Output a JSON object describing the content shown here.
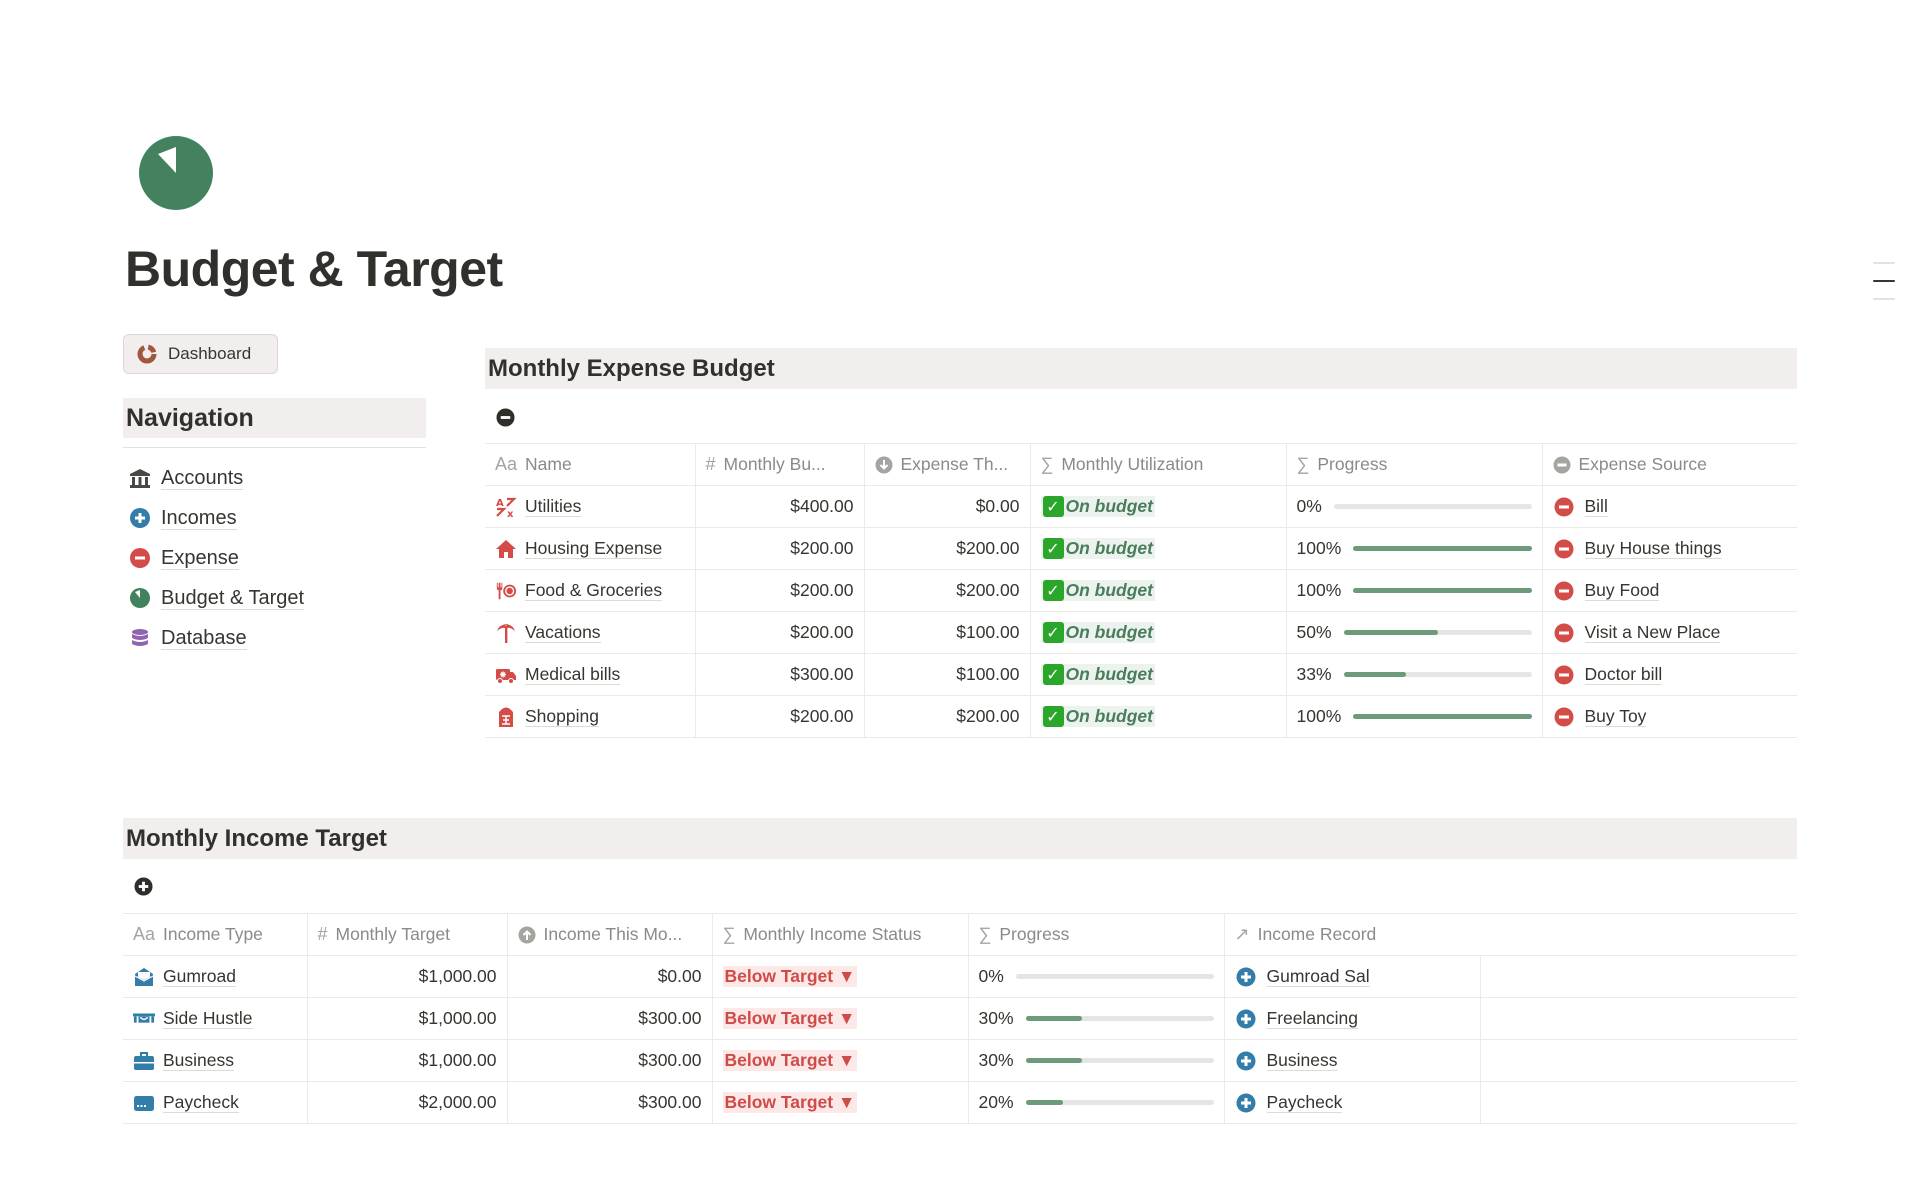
{
  "page": {
    "title": "Budget & Target",
    "icon": "budget-pie-icon",
    "accent": "#44825f"
  },
  "dashboard_button": {
    "label": "Dashboard",
    "icon": "dashboard-ring-icon"
  },
  "navigation": {
    "heading": "Navigation",
    "items": [
      {
        "label": "Accounts",
        "icon": "bank-icon"
      },
      {
        "label": "Incomes",
        "icon": "plus-circle-icon"
      },
      {
        "label": "Expense",
        "icon": "minus-circle-icon"
      },
      {
        "label": "Budget & Target",
        "icon": "budget-pie-icon"
      },
      {
        "label": "Database",
        "icon": "database-icon"
      }
    ]
  },
  "expense_budget": {
    "title": "Monthly Expense Budget",
    "view_icon": "minus-circle-icon",
    "columns": [
      {
        "label": "Name",
        "type_glyph": "Aa"
      },
      {
        "label": "Monthly Bu...",
        "type_glyph": "#"
      },
      {
        "label": "Expense Th...",
        "type_glyph": "arrow-down-circle"
      },
      {
        "label": "Monthly Utilization",
        "type_glyph": "∑"
      },
      {
        "label": "Progress",
        "type_glyph": "∑"
      },
      {
        "label": "Expense Source",
        "type_glyph": "minus-circle"
      }
    ],
    "rows": [
      {
        "name": "Utilities",
        "icon": "translate-icon",
        "budget": "$400.00",
        "spent": "$0.00",
        "status": "On budget",
        "progress_label": "0%",
        "progress": 0,
        "source": "Bill"
      },
      {
        "name": "Housing Expense",
        "icon": "house-icon",
        "budget": "$200.00",
        "spent": "$200.00",
        "status": "On budget",
        "progress_label": "100%",
        "progress": 100,
        "source": "Buy House things"
      },
      {
        "name": "Food & Groceries",
        "icon": "fork-plate-icon",
        "budget": "$200.00",
        "spent": "$200.00",
        "status": "On budget",
        "progress_label": "100%",
        "progress": 100,
        "source": "Buy Food"
      },
      {
        "name": "Vacations",
        "icon": "palm-tree-icon",
        "budget": "$200.00",
        "spent": "$100.00",
        "status": "On budget",
        "progress_label": "50%",
        "progress": 50,
        "source": "Visit a New Place"
      },
      {
        "name": "Medical bills",
        "icon": "ambulance-icon",
        "budget": "$300.00",
        "spent": "$100.00",
        "status": "On budget",
        "progress_label": "33%",
        "progress": 33,
        "source": "Doctor bill"
      },
      {
        "name": "Shopping",
        "icon": "shopping-tag-icon",
        "budget": "$200.00",
        "spent": "$200.00",
        "status": "On budget",
        "progress_label": "100%",
        "progress": 100,
        "source": "Buy Toy"
      }
    ]
  },
  "income_target": {
    "title": "Monthly Income Target",
    "view_icon": "plus-circle-icon",
    "columns": [
      {
        "label": "Income Type",
        "type_glyph": "Aa"
      },
      {
        "label": "Monthly Target",
        "type_glyph": "#"
      },
      {
        "label": "Income This Mo...",
        "type_glyph": "arrow-up-circle"
      },
      {
        "label": "Monthly Income Status",
        "type_glyph": "∑"
      },
      {
        "label": "Progress",
        "type_glyph": "∑"
      },
      {
        "label": "Income Record",
        "type_glyph": "↗"
      }
    ],
    "rows": [
      {
        "name": "Gumroad",
        "icon": "envelope-open-icon",
        "target": "$1,000.00",
        "earned": "$0.00",
        "status": "Below Target ▼",
        "progress_label": "0%",
        "progress": 0,
        "record": "Gumroad Sal"
      },
      {
        "name": "Side Hustle",
        "icon": "money-icon",
        "target": "$1,000.00",
        "earned": "$300.00",
        "status": "Below Target ▼",
        "progress_label": "30%",
        "progress": 30,
        "record": "Freelancing"
      },
      {
        "name": "Business",
        "icon": "briefcase-icon",
        "target": "$1,000.00",
        "earned": "$300.00",
        "status": "Below Target ▼",
        "progress_label": "30%",
        "progress": 30,
        "record": "Business"
      },
      {
        "name": "Paycheck",
        "icon": "card-icon",
        "target": "$2,000.00",
        "earned": "$300.00",
        "status": "Below Target ▼",
        "progress_label": "20%",
        "progress": 20,
        "record": "Paycheck"
      }
    ]
  },
  "colors": {
    "expense_red": "#d44c47",
    "income_blue": "#337ea9",
    "progress_green": "#6d9a7b",
    "on_budget_green": "#4a7d5b",
    "below_target_red": "#cf4b48",
    "section_bg": "#f3eeee"
  }
}
